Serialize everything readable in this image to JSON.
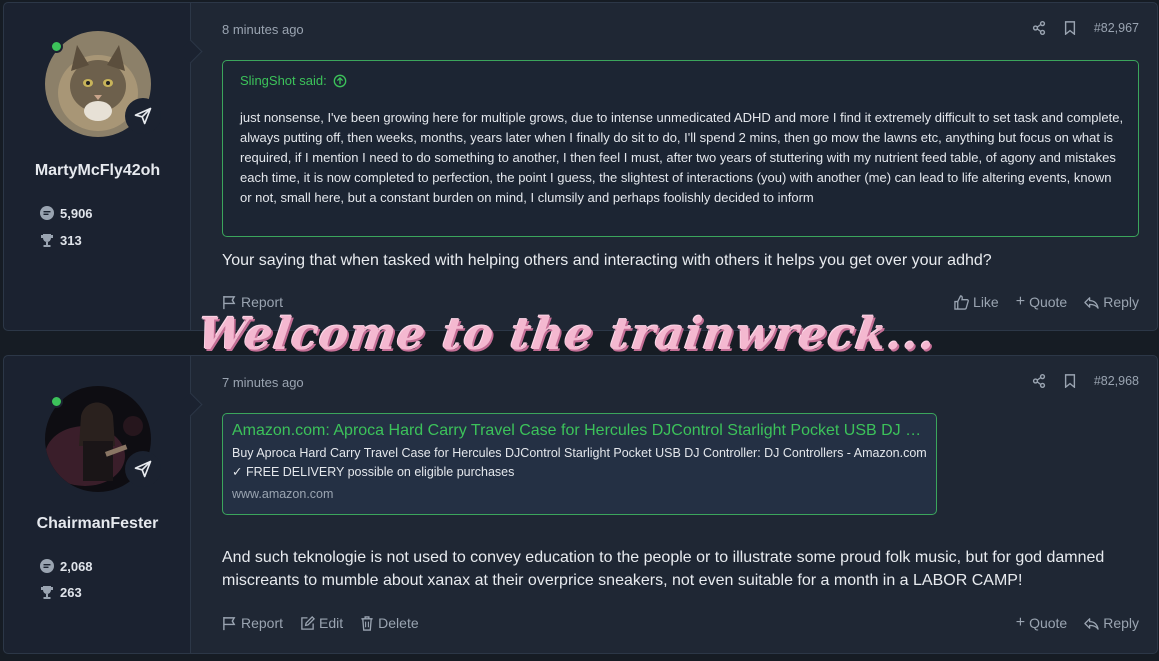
{
  "overlay_text": "Welcome to the trainwreck...",
  "posts": [
    {
      "username": "MartyMcFly42oh",
      "messages_count": "5,906",
      "reactions_count": "313",
      "time": "8 minutes ago",
      "post_number": "#82,967",
      "quote": {
        "author_label": "SlingShot said:",
        "text": "just nonsense, I've been growing here for multiple grows, due to intense unmedicated ADHD and more I find it extremely difficult to set task and complete, always putting off, then weeks, months, years later when I finally do sit to do, I'll spend 2 mins, then go mow the lawns etc, anything but focus on what is required, if I mention I need to do something to another, I then feel I must, after two years of stuttering with my nutrient feed table, of agony and mistakes each time, it is now completed to perfection, the point I guess, the slightest of interactions (you) with another (me) can lead to life altering events, known or not, small here, but a constant burden on mind, I clumsily and perhaps foolishly decided to inform"
      },
      "message": "Your saying that when tasked with helping others and interacting with others it helps you get over your adhd?",
      "actions": {
        "report": "Report",
        "like": "Like",
        "quote": "Quote",
        "reply": "Reply"
      }
    },
    {
      "username": "ChairmanFester",
      "messages_count": "2,068",
      "reactions_count": "263",
      "time": "7 minutes ago",
      "post_number": "#82,968",
      "link_card": {
        "title": "Amazon.com: Aproca Hard Carry Travel Case for Hercules DJControl Starlight Pocket USB DJ Controller",
        "description": "Buy Aproca Hard Carry Travel Case for Hercules DJControl Starlight Pocket USB DJ Controller: DJ Controllers - Amazon.com ✓ FREE DELIVERY possible on eligible purchases",
        "domain": "www.amazon.com"
      },
      "message": "And such teknologie is not used to convey education to the people or to illustrate some proud folk music, but for god damned miscreants to mumble about xanax at their overprice sneakers, not even suitable for a month in a LABOR CAMP!",
      "actions": {
        "report": "Report",
        "edit": "Edit",
        "delete": "Delete",
        "quote": "Quote",
        "reply": "Reply"
      }
    }
  ],
  "colors": {
    "accent": "#3cc25a",
    "background": "#161c24",
    "panel": "#1f2734",
    "overlay": "#f4b8d0"
  }
}
